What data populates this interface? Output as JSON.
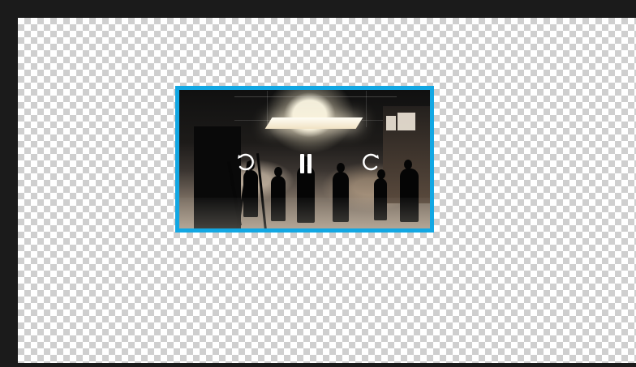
{
  "window": {
    "background": "#1b1b1b"
  },
  "canvas": {
    "pattern": "transparency-checkerboard"
  },
  "video_clip": {
    "selection_color": "#12a7e3",
    "scene": "studio-set-with-crew-silhouettes"
  },
  "controls": {
    "rewind_icon": "rotate-ccw-icon",
    "pause_icon": "pause-icon",
    "forward_icon": "rotate-cw-icon"
  }
}
